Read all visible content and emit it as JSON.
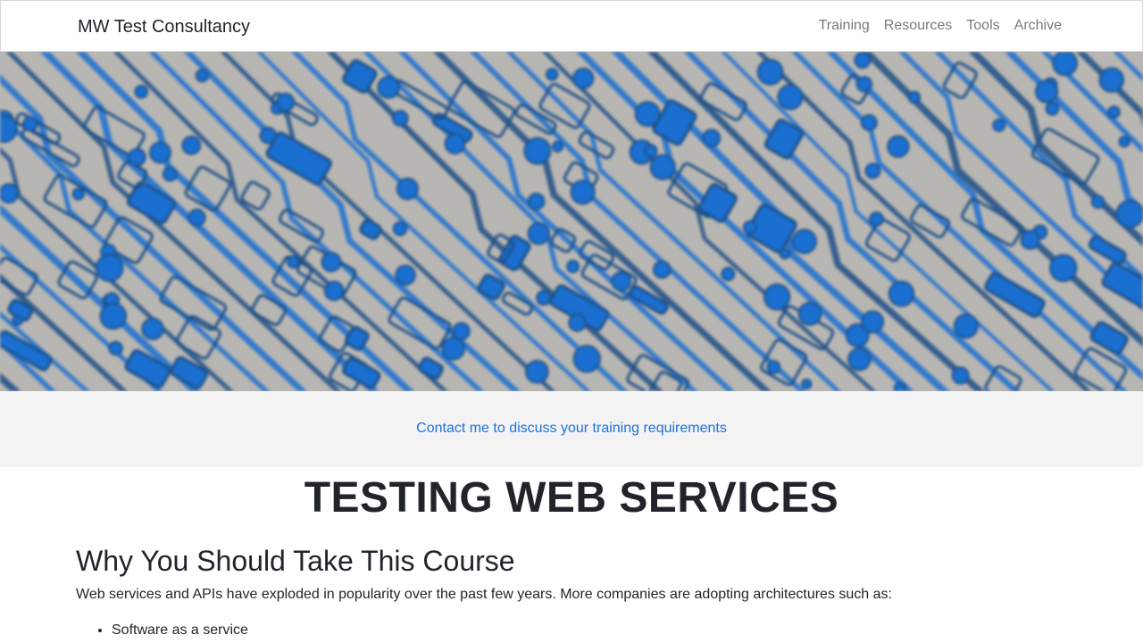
{
  "navbar": {
    "brand": "MW Test Consultancy",
    "links": [
      {
        "label": "Training"
      },
      {
        "label": "Resources"
      },
      {
        "label": "Tools"
      },
      {
        "label": "Archive"
      }
    ]
  },
  "contact": {
    "link_text": "Contact me to discuss your training requirements",
    "link_color": "#1a73e8"
  },
  "page": {
    "title": "TESTING WEB SERVICES",
    "section_heading": "Why You Should Take This Course",
    "intro_text": "Web services and APIs have exploded in popularity over the past few years. More companies are adopting architectures such as:",
    "bullets": [
      "Software as a service"
    ]
  },
  "colors": {
    "hero_blue": "#1a6fd0",
    "hero_dark": "#1d4f86",
    "hero_background": "#b8b6b2",
    "band_background": "#f3f3f3"
  }
}
